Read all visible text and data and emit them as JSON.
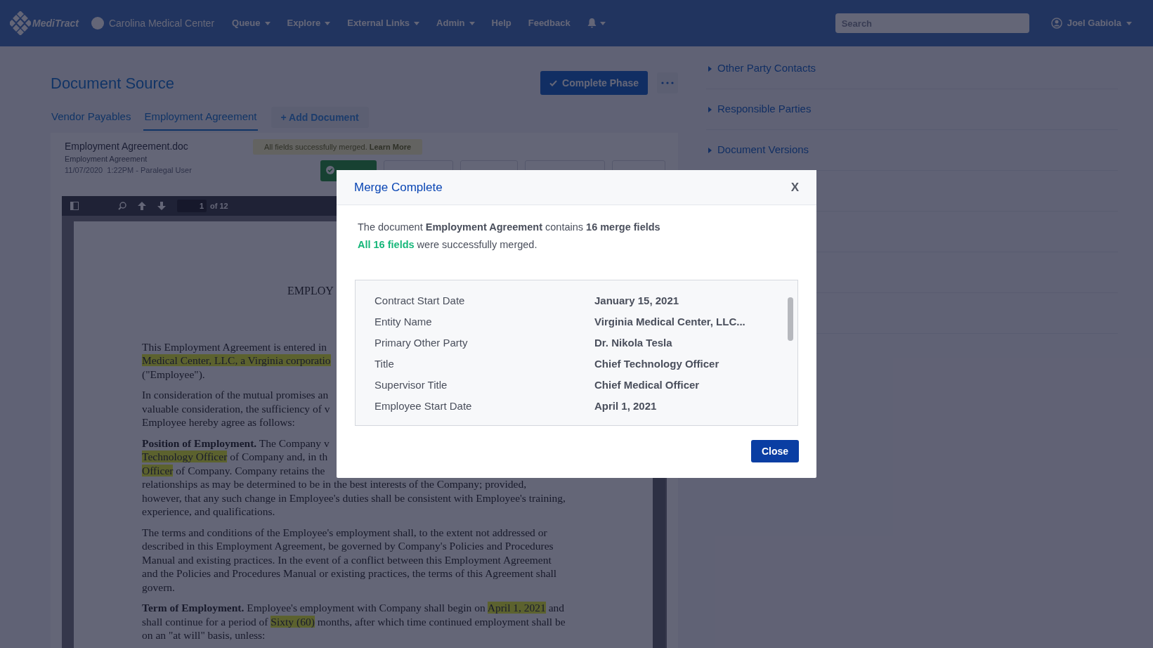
{
  "nav": {
    "brand": "MediTract",
    "org": "Carolina Medical Center",
    "menu": [
      {
        "label": "Queue",
        "dropdown": true
      },
      {
        "label": "Explore",
        "dropdown": true
      },
      {
        "label": "External Links",
        "dropdown": true
      },
      {
        "label": "Admin",
        "dropdown": true
      },
      {
        "label": "Help",
        "dropdown": false
      },
      {
        "label": "Feedback",
        "dropdown": false
      }
    ],
    "search": {
      "placeholder": "Search"
    },
    "user": "Joel Gabiola"
  },
  "page": {
    "title": "Document Source",
    "complete_button": "Complete Phase",
    "tabs": [
      {
        "label": "Vendor Payables",
        "selected": false
      },
      {
        "label": "Employment Agreement",
        "selected": true
      }
    ],
    "add_document": "+ Add Document",
    "file": {
      "name": "Employment Agreement.doc",
      "type": "Employment Agreement",
      "meta": "11/07/2020  1:22PM - Paralegal User"
    },
    "alert": "All fields successfully merged. **Learn More**",
    "viewer": {
      "page": "1",
      "page_count": "of 12"
    },
    "document": {
      "heading": "EMPLOY",
      "paragraphs": [
        [
          [
            {
              "kind": "plain",
              "text": "This Employment Agreement is entered in"
            }
          ],
          [
            {
              "kind": "highlight",
              "text": "Medical Center, LLC, a Virginia corporatio"
            }
          ],
          [
            {
              "kind": "plain",
              "text": "(\"Employee\")."
            }
          ]
        ],
        [
          [
            {
              "kind": "plain",
              "text": "In consideration of the mutual promises an"
            }
          ],
          [
            {
              "kind": "plain",
              "text": "valuable consideration, the sufficiency of v"
            }
          ],
          [
            {
              "kind": "plain",
              "text": "Employee hereby agree as follows:"
            }
          ]
        ],
        [
          [
            {
              "kind": "bold",
              "text": "Position of Employment."
            },
            {
              "kind": "plain",
              "text": " The Company v"
            }
          ],
          [
            {
              "kind": "highlight",
              "text": "Technology Officer"
            },
            {
              "kind": "plain",
              "text": " of Company and, in th"
            }
          ],
          [
            {
              "kind": "highlight",
              "text": "Officer"
            },
            {
              "kind": "plain",
              "text": " of Company. Company retains the"
            }
          ],
          [
            {
              "kind": "plain",
              "text": "relationships as may be determined to be in the best interests of the Company; provided,"
            }
          ],
          [
            {
              "kind": "plain",
              "text": "however, that any such change in Employee's duties shall be consistent with Employee's training,"
            }
          ],
          [
            {
              "kind": "plain",
              "text": "experience, and qualifications."
            }
          ]
        ],
        [
          [
            {
              "kind": "plain",
              "text": "The terms and conditions of the Employee's employment shall, to the extent not addressed or"
            }
          ],
          [
            {
              "kind": "plain",
              "text": "described in this Employment Agreement, be governed by Company's Policies and Procedures"
            }
          ],
          [
            {
              "kind": "plain",
              "text": "Manual and existing practices. In the event of a conflict between this Employment Agreement"
            }
          ],
          [
            {
              "kind": "plain",
              "text": "and the Policies and Procedures Manual or existing practices, the terms of this Agreement shall"
            }
          ],
          [
            {
              "kind": "plain",
              "text": "govern."
            }
          ]
        ],
        [
          [
            {
              "kind": "bold",
              "text": "Term of Employment."
            },
            {
              "kind": "plain",
              "text": " Employee's employment with Company shall begin on "
            },
            {
              "kind": "highlight",
              "text": "April 1, 2021"
            },
            {
              "kind": "plain",
              "text": " and"
            }
          ],
          [
            {
              "kind": "plain",
              "text": "shall continue for a period of "
            },
            {
              "kind": "highlight",
              "text": "Sixty (60)"
            },
            {
              "kind": "plain",
              "text": " months, after which time continued employment shall be"
            }
          ],
          [
            {
              "kind": "plain",
              "text": "on an \"at will\" basis, unless:"
            }
          ]
        ]
      ]
    }
  },
  "sidebar": {
    "sections": [
      {
        "label": "Other Party Contacts",
        "expanded": false
      },
      {
        "label": "Responsible Parties",
        "expanded": false
      },
      {
        "label": "Document Versions",
        "expanded": false
      }
    ]
  },
  "modal": {
    "title": "Merge Complete",
    "close_x": "X",
    "summary": "The document **Employment Agreement** contains **16 merge fields**",
    "result": {
      "emphasis": "All 16 fields",
      "rest": " were successfully merged."
    },
    "fields": [
      {
        "label": "Contract Start Date",
        "value": "January 15, 2021"
      },
      {
        "label": "Entity Name",
        "value": "Virginia Medical Center, LLC..."
      },
      {
        "label": "Primary Other Party",
        "value": "Dr. Nikola Tesla"
      },
      {
        "label": "Title",
        "value": "Chief Technology Officer"
      },
      {
        "label": "Supervisor Title",
        "value": "Chief Medical Officer"
      },
      {
        "label": "Employee Start Date",
        "value": "April 1, 2021"
      }
    ],
    "close_button": "Close"
  }
}
